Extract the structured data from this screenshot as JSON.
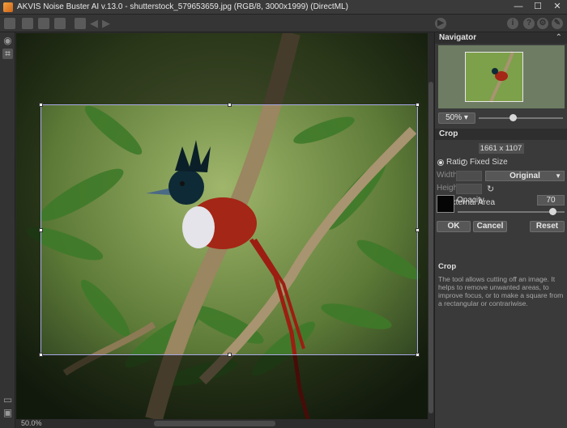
{
  "window": {
    "title": "AKVIS Noise Buster AI v.13.0 - shutterstock_579653659.jpg (RGB/8, 3000x1999) (DirectML)",
    "controls": [
      "—",
      "☐",
      "✕"
    ]
  },
  "statusbar": {
    "zoom": "50.0%"
  },
  "navigator": {
    "title": "Navigator",
    "zoom_value": "50%"
  },
  "crop": {
    "title": "Crop",
    "dimensions": "1661 x 1107",
    "ratio_label": "Ratio",
    "fixed_size_label": "Fixed Size",
    "width_label": "Width",
    "height_label": "Height",
    "width_value": "",
    "height_value": "",
    "preset": "Original",
    "external_area_label": "External Area",
    "external_area_checked": true,
    "opacity_label": "Opacity",
    "opacity_value": "70",
    "external_color": "#050505",
    "ok_label": "OK",
    "cancel_label": "Cancel",
    "reset_label": "Reset"
  },
  "help": {
    "title": "Crop",
    "text": "The tool allows cutting off an image. It helps to remove unwanted areas, to improve focus, or to make a square from a rectangular or contrariwise."
  },
  "icons": {
    "toolbar": [
      "open-icon",
      "save-icon",
      "save-as-icon",
      "print-icon",
      "share-icon",
      "undo-icon",
      "redo-icon",
      "run-icon",
      "info-icon",
      "help-icon",
      "settings-icon",
      "preferences-icon"
    ],
    "left": [
      "hand-icon",
      "crop-icon",
      "before-after-icon",
      "bottom-tool-icon"
    ]
  }
}
